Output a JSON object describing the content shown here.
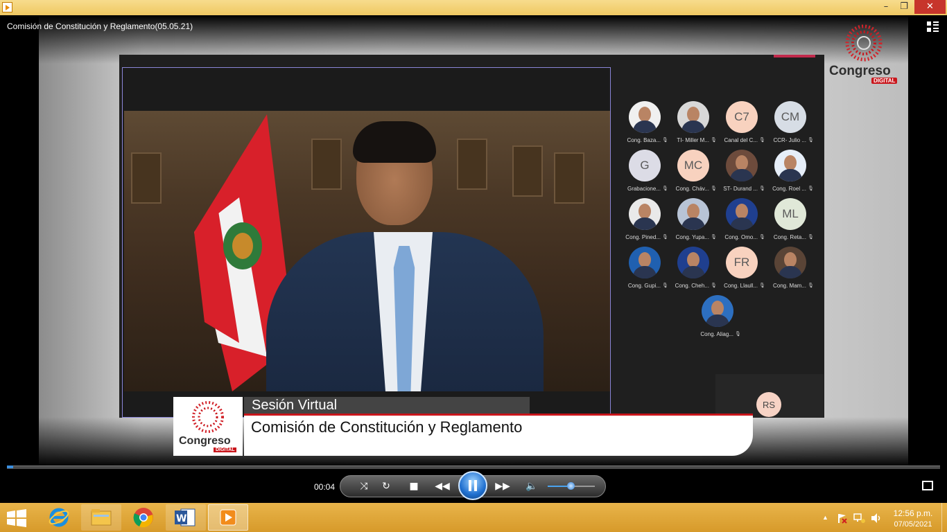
{
  "window": {
    "controls": {
      "minimize": "–",
      "maximize": "❐",
      "close": "✕"
    }
  },
  "media": {
    "title": "Comisión de Constitución y Reglamento(05.05.21)"
  },
  "brand": {
    "name": "Congreso",
    "tag": "DIGITAL"
  },
  "lower_third": {
    "session": "Sesión Virtual",
    "name": "Comisión de Constitución y Reglamento"
  },
  "participants": [
    {
      "name": "Cong. Baza...",
      "initials": "",
      "color": "#f0f0f0"
    },
    {
      "name": "TI- Miller M...",
      "initials": "",
      "color": "#d8d8d8"
    },
    {
      "name": "Canal del C...",
      "initials": "C7",
      "color": "#f8d2bf"
    },
    {
      "name": "CCR- Julio ...",
      "initials": "CM",
      "color": "#d7dde5"
    },
    {
      "name": "Grabacione...",
      "initials": "G",
      "color": "#dcdce6"
    },
    {
      "name": "Cong. Cháv...",
      "initials": "MC",
      "color": "#f8d2bf"
    },
    {
      "name": "ST- Durand ...",
      "initials": "",
      "color": "#6d4b3c"
    },
    {
      "name": "Cong. Roel ...",
      "initials": "",
      "color": "#e6eef8"
    },
    {
      "name": "Cong. Pined...",
      "initials": "",
      "color": "#e9e9e9"
    },
    {
      "name": "Cong. Yupa...",
      "initials": "",
      "color": "#b8c4d6"
    },
    {
      "name": "Cong. Omo...",
      "initials": "",
      "color": "#1f3f8f"
    },
    {
      "name": "Cong. Reta...",
      "initials": "ML",
      "color": "#e0e8d8"
    },
    {
      "name": "Cong. Gupi...",
      "initials": "",
      "color": "#2060b0"
    },
    {
      "name": "Cong. Cheh...",
      "initials": "",
      "color": "#1f3f8f"
    },
    {
      "name": "Cong. Llaull...",
      "initials": "FR",
      "color": "#f8d2bf"
    },
    {
      "name": "Cong. Mam...",
      "initials": "",
      "color": "#5a4436"
    },
    {
      "name": "Cong. Aliag...",
      "initials": "",
      "color": "#2d6fc0"
    }
  ],
  "active_speaker_tile": {
    "initials": "RS"
  },
  "player": {
    "elapsed": "00:04",
    "progress": 0.007,
    "volume": 0.5
  },
  "taskbar": {
    "clock_time": "12:56 p.m.",
    "clock_date": "07/05/2021"
  }
}
